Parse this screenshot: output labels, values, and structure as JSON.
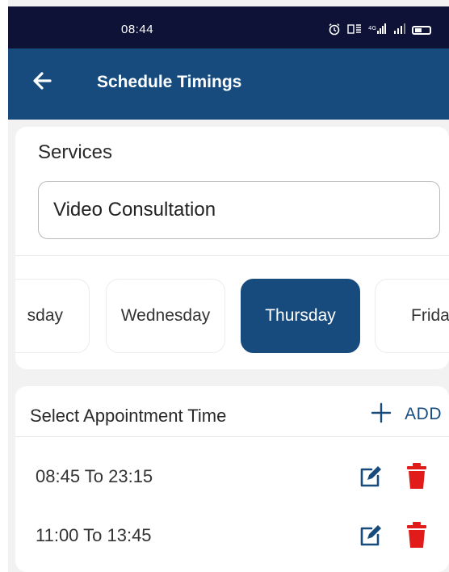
{
  "status_bar": {
    "time": "08:44",
    "icons": [
      "alarm-icon",
      "data-icon",
      "signal-icon",
      "wifi-signal-icon",
      "battery-icon"
    ],
    "icon_glyphs": "⏰ ▦ ¹²▌ ▌"
  },
  "app_bar": {
    "title": "Schedule Timings",
    "color": "#174b7e"
  },
  "services": {
    "label": "Services",
    "value": "Video Consultation"
  },
  "days": [
    {
      "label": "sday",
      "active": false
    },
    {
      "label": "Wednesday",
      "active": false
    },
    {
      "label": "Thursday",
      "active": true
    },
    {
      "label": "Frida",
      "active": false
    }
  ],
  "appointment": {
    "header": "Select Appointment Time",
    "add_label": "ADD",
    "slots": [
      {
        "text": "08:45 To 23:15"
      },
      {
        "text": "11:00 To 13:45"
      }
    ]
  },
  "colors": {
    "primary": "#174b7e",
    "status_bar": "#0d1236",
    "delete": "#e11a1a"
  }
}
